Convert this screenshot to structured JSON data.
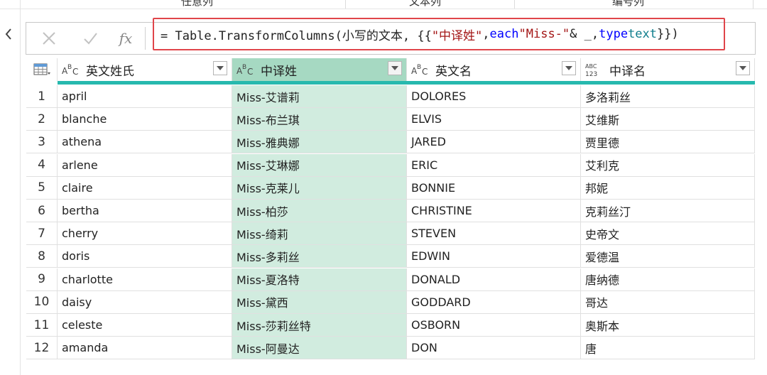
{
  "ribbon": {
    "labels": [
      "任意列",
      "文本列",
      "编号列"
    ]
  },
  "formula_bar": {
    "cancel_icon": "close-icon",
    "commit_icon": "checkmark-icon",
    "fx_label": "fx",
    "formula_parts": {
      "p1": "= Table.TransformColumns(小写的文本, {{",
      "p2": "\"中译姓\"",
      "p3": ", ",
      "p4": "each",
      "p5": " ",
      "p6": "\"Miss-\"",
      "p7": " & _, ",
      "p8": "type",
      "p9": " ",
      "p10": "text",
      "p11": "}})"
    }
  },
  "table": {
    "columns": [
      {
        "type_icon": "text-type-icon",
        "name": "英文姓氏"
      },
      {
        "type_icon": "text-type-icon",
        "name": "中译姓"
      },
      {
        "type_icon": "text-type-icon",
        "name": "英文名"
      },
      {
        "type_icon": "any-type-icon",
        "name": "中译名"
      }
    ],
    "rows": [
      {
        "n": "1",
        "c1": "april",
        "c2": "Miss-艾谱莉",
        "c3": "DOLORES",
        "c4": "多洛莉丝"
      },
      {
        "n": "2",
        "c1": "blanche",
        "c2": "Miss-布兰琪",
        "c3": "ELVIS",
        "c4": "艾维斯"
      },
      {
        "n": "3",
        "c1": "athena",
        "c2": "Miss-雅典娜",
        "c3": "JARED",
        "c4": "贾里德"
      },
      {
        "n": "4",
        "c1": "arlene",
        "c2": "Miss-艾琳娜",
        "c3": "ERIC",
        "c4": "艾利克"
      },
      {
        "n": "5",
        "c1": "claire",
        "c2": "Miss-克莱儿",
        "c3": "BONNIE",
        "c4": "邦妮"
      },
      {
        "n": "6",
        "c1": "bertha",
        "c2": "Miss-柏莎",
        "c3": "CHRISTINE",
        "c4": "克莉丝汀"
      },
      {
        "n": "7",
        "c1": "cherry",
        "c2": "Miss-绮莉",
        "c3": "STEVEN",
        "c4": "史帝文"
      },
      {
        "n": "8",
        "c1": "doris",
        "c2": "Miss-多莉丝",
        "c3": "EDWIN",
        "c4": "爱德温"
      },
      {
        "n": "9",
        "c1": "charlotte",
        "c2": "Miss-夏洛特",
        "c3": "DONALD",
        "c4": "唐纳德"
      },
      {
        "n": "10",
        "c1": "daisy",
        "c2": "Miss-黛西",
        "c3": "GODDARD",
        "c4": "哥达"
      },
      {
        "n": "11",
        "c1": "celeste",
        "c2": "Miss-莎莉丝特",
        "c3": "OSBORN",
        "c4": "奥斯本"
      },
      {
        "n": "12",
        "c1": "amanda",
        "c2": "Miss-阿曼达",
        "c3": "DON",
        "c4": "唐"
      }
    ]
  },
  "colors": {
    "selected_header": "#a6d9c2",
    "selected_cell": "#d1ecdf",
    "quality_bar": "#27b9ae",
    "highlight_border": "#e0454a"
  }
}
